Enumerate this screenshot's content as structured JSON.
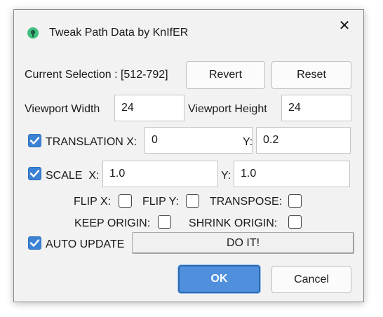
{
  "window": {
    "title": "Tweak Path Data by KnIfER",
    "close_glyph": "✕"
  },
  "selection": {
    "label": "Current Selection : [512-792]",
    "revert_label": "Revert",
    "reset_label": "Reset"
  },
  "viewport": {
    "width_label": "Viewport Width",
    "width_value": "24",
    "height_label": "Viewport Height",
    "height_value": "24"
  },
  "translation": {
    "label": "TRANSLATION X:",
    "checked": true,
    "x_value": "0",
    "y_label": "Y:",
    "y_value": "0.2"
  },
  "scale": {
    "label": "SCALE  X:",
    "checked": true,
    "x_value": "1.0",
    "y_label": "Y:",
    "y_value": "1.0"
  },
  "options": {
    "flip_x_label": "FLIP X:",
    "flip_x": false,
    "flip_y_label": "FLIP Y:",
    "flip_y": false,
    "transpose_label": "TRANSPOSE:",
    "transpose": false,
    "keep_origin_label": "KEEP ORIGIN:",
    "keep_origin": false,
    "shrink_origin_label": "SHRINK ORIGIN:",
    "shrink_origin": false
  },
  "auto_update": {
    "label": "AUTO UPDATE",
    "checked": true
  },
  "do_it_label": "DO IT!",
  "footer": {
    "ok_label": "OK",
    "cancel_label": "Cancel"
  },
  "colors": {
    "accent": "#3c82d4",
    "ok_button": "#4f8fdb",
    "dialog_bg": "#f2f2f2",
    "app_icon": "#3fbf7f"
  }
}
